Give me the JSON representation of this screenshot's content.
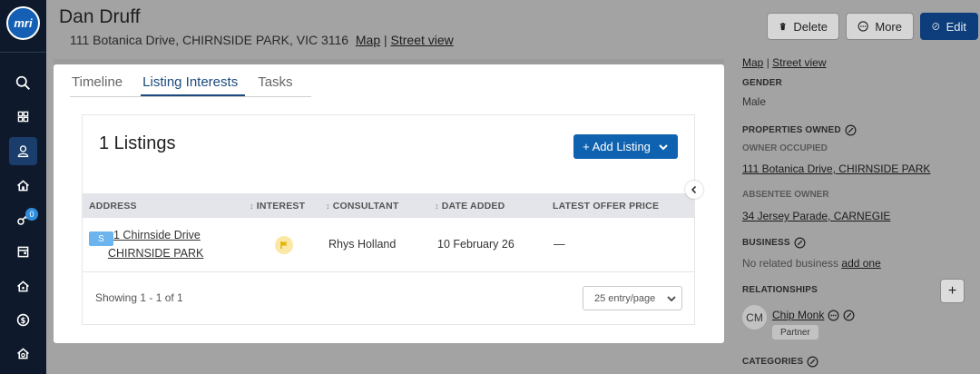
{
  "app": {
    "logo_text": "mri"
  },
  "sidebar": {
    "badge_count": "0",
    "items": [
      {
        "name": "search-icon"
      },
      {
        "name": "dashboard-icon"
      },
      {
        "name": "contacts-icon",
        "active": true
      },
      {
        "name": "home-icon"
      },
      {
        "name": "key-icon"
      },
      {
        "name": "calendar-icon"
      },
      {
        "name": "property-icon"
      },
      {
        "name": "dollar-icon"
      },
      {
        "name": "house-settings-icon"
      }
    ]
  },
  "header": {
    "name": "Dan Druff",
    "address": "111 Botanica Drive, CHIRNSIDE PARK, VIC 3116",
    "map_link": "Map",
    "separator": "|",
    "street_view_link": "Street view",
    "buttons": {
      "delete": "Delete",
      "more": "More",
      "edit": "Edit"
    }
  },
  "right_panel": {
    "map_link": "Map",
    "street_view_link": "Street view",
    "gender_label": "GENDER",
    "gender_value": "Male",
    "properties_owned_label": "PROPERTIES OWNED",
    "owner_occupied_label": "OWNER OCCUPIED",
    "owner_occupied_value": "111 Botanica Drive, CHIRNSIDE PARK",
    "absentee_owner_label": "ABSENTEE OWNER",
    "absentee_owner_value": "34 Jersey Parade, CARNEGIE",
    "business_label": "BUSINESS",
    "business_empty": "No related business",
    "business_add": "add one",
    "relationships_label": "RELATIONSHIPS",
    "relationship": {
      "initials": "CM",
      "name": "Chip Monk",
      "tag": "Partner"
    },
    "categories_label": "CATEGORIES",
    "plus_label": "+"
  },
  "tabs": [
    {
      "label": "Timeline",
      "active": false
    },
    {
      "label": "Listing Interests",
      "active": true
    },
    {
      "label": "Tasks",
      "active": false
    }
  ],
  "listings": {
    "title": "1 Listings",
    "add_button": "+ Add Listing",
    "columns": {
      "address": "ADDRESS",
      "interest": "INTEREST",
      "consultant": "CONSULTANT",
      "date_added": "DATE ADDED",
      "latest_offer": "LATEST OFFER PRICE"
    },
    "rows": [
      {
        "badge": "S",
        "address_line1": "1 Chirnside Drive",
        "address_line2": "CHIRNSIDE PARK",
        "consultant": "Rhys Holland",
        "date_added": "10 February 26",
        "latest_offer": "—"
      }
    ],
    "showing": "Showing 1 - 1 of 1",
    "per_page": "25 entry/page"
  }
}
